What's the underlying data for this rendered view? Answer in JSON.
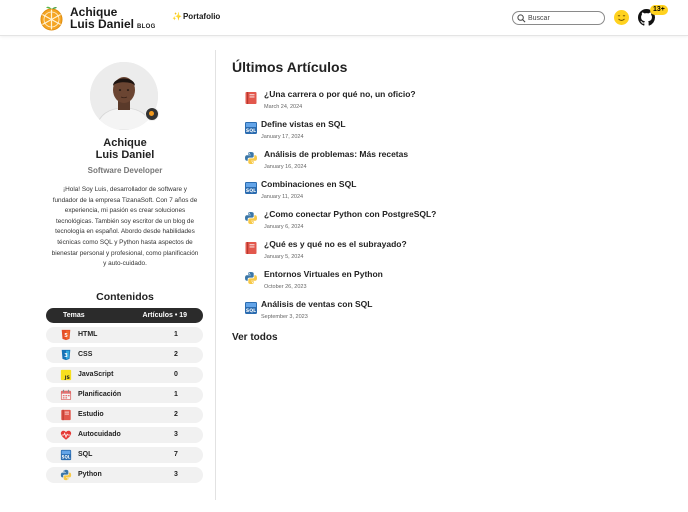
{
  "header": {
    "brand_line1": "Achique",
    "brand_line2": "Luis Daniel",
    "brand_tag": "BLOG",
    "portfolio_icon": "✨",
    "portfolio_label": "Portafolio",
    "search_placeholder": "Buscar",
    "theme_icon": "sun-face-icon",
    "github_icon": "github-icon",
    "github_badge": "13+"
  },
  "sidebar": {
    "name_line1": "Achique",
    "name_line2": "Luis Daniel",
    "role": "Software Developer",
    "bio": "¡Hola! Soy Luis, desarrollador de software y fundador de la empresa TizanaSoft. Con 7 años de experiencia, mi pasión es crear soluciones tecnológicas. También soy escritor de un blog de tecnología en español. Abordo desde habilidades técnicas como SQL y Python hasta aspectos de bienestar personal y profesional, como planificación y auto-cuidado.",
    "contents_title": "Contenidos",
    "topics_header": {
      "left": "Temas",
      "right": "Artículos • 19"
    },
    "topics": [
      {
        "label": "HTML",
        "count": "1",
        "icon": "html5-icon"
      },
      {
        "label": "CSS",
        "count": "2",
        "icon": "css3-icon"
      },
      {
        "label": "JavaScript",
        "count": "0",
        "icon": "javascript-icon"
      },
      {
        "label": "Planificación",
        "count": "1",
        "icon": "calendar-icon"
      },
      {
        "label": "Estudio",
        "count": "2",
        "icon": "book-icon"
      },
      {
        "label": "Autocuidado",
        "count": "3",
        "icon": "heartbeat-icon"
      },
      {
        "label": "SQL",
        "count": "7",
        "icon": "sql-icon"
      },
      {
        "label": "Python",
        "count": "3",
        "icon": "python-icon"
      }
    ]
  },
  "main": {
    "title": "Últimos Artículos",
    "articles": [
      {
        "title": "¿Una carrera o por qué no, un oficio?",
        "date": "March 24, 2024",
        "icon": "book-icon"
      },
      {
        "title": "Define vistas en SQL",
        "date": "January 17, 2024",
        "icon": "sql-icon"
      },
      {
        "title": "Análisis de problemas: Más recetas",
        "date": "January 16, 2024",
        "icon": "python-icon"
      },
      {
        "title": "Combinaciones en SQL",
        "date": "January 11, 2024",
        "icon": "sql-icon"
      },
      {
        "title": "¿Como conectar Python con PostgreSQL?",
        "date": "January 6, 2024",
        "icon": "python-icon"
      },
      {
        "title": "¿Qué es y qué no es el subrayado?",
        "date": "January 5, 2024",
        "icon": "book-icon"
      },
      {
        "title": "Entornos Virtuales en Python",
        "date": "October 26, 2023",
        "icon": "python-icon"
      },
      {
        "title": "Análisis de ventas con SQL",
        "date": "September 3, 2023",
        "icon": "sql-icon"
      }
    ],
    "see_all": "Ver todos"
  }
}
